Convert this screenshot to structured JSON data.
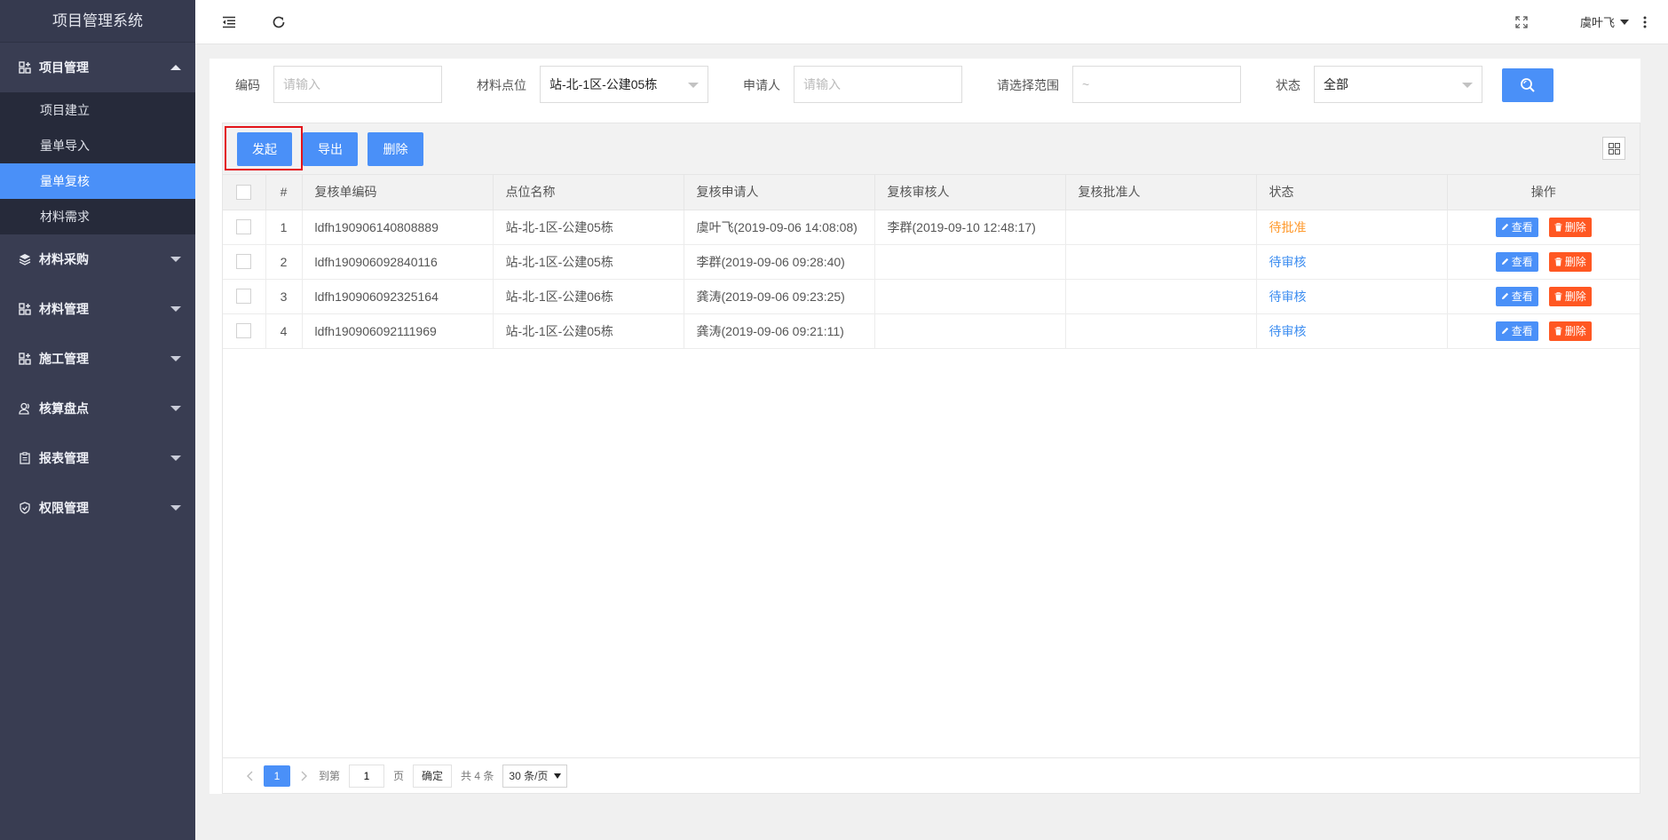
{
  "app": {
    "title": "项目管理系统"
  },
  "sidebar": {
    "groups": [
      {
        "label": "项目管理",
        "icon": "grid-plus-icon",
        "expanded": true,
        "items": [
          {
            "label": "项目建立",
            "active": false
          },
          {
            "label": "量单导入",
            "active": false
          },
          {
            "label": "量单复核",
            "active": true
          },
          {
            "label": "材料需求",
            "active": false
          }
        ]
      },
      {
        "label": "材料采购",
        "icon": "layers-icon",
        "expanded": false
      },
      {
        "label": "材料管理",
        "icon": "grid-plus-icon",
        "expanded": false
      },
      {
        "label": "施工管理",
        "icon": "grid-plus-icon",
        "expanded": false
      },
      {
        "label": "核算盘点",
        "icon": "user-group-icon",
        "expanded": false
      },
      {
        "label": "报表管理",
        "icon": "clipboard-icon",
        "expanded": false
      },
      {
        "label": "权限管理",
        "icon": "shield-check-icon",
        "expanded": false
      }
    ]
  },
  "topbar": {
    "menu_icon": "menu-indent-icon",
    "refresh_icon": "refresh-icon",
    "fullscreen_icon": "fullscreen-icon",
    "user_name": "虞叶飞",
    "more_icon": "more-vertical-icon"
  },
  "filters": {
    "code_label": "编码",
    "code_placeholder": "请输入",
    "site_label": "材料点位",
    "site_value": "站-北-1区-公建05栋",
    "applicant_label": "申请人",
    "applicant_placeholder": "请输入",
    "range_label": "请选择范围",
    "range_placeholder": "~",
    "status_label": "状态",
    "status_value": "全部",
    "search_icon": "search-icon"
  },
  "toolbar": {
    "start_label": "发起",
    "export_label": "导出",
    "delete_label": "删除",
    "columns_icon": "columns-grid-icon"
  },
  "table": {
    "columns": [
      "#",
      "复核单编码",
      "点位名称",
      "复核申请人",
      "复核审核人",
      "复核批准人",
      "状态",
      "操作"
    ],
    "rows": [
      {
        "index": "1",
        "code": "ldfh190906140808889",
        "site": "站-北-1区-公建05栋",
        "applicant": "虞叶飞(2019-09-06 14:08:08)",
        "reviewer": "李群(2019-09-10 12:48:17)",
        "approver": "",
        "status": "待批准",
        "status_color": "#ff9a2e"
      },
      {
        "index": "2",
        "code": "ldfh190906092840116",
        "site": "站-北-1区-公建05栋",
        "applicant": "李群(2019-09-06 09:28:40)",
        "reviewer": "",
        "approver": "",
        "status": "待审核",
        "status_color": "#3c8df0"
      },
      {
        "index": "3",
        "code": "ldfh190906092325164",
        "site": "站-北-1区-公建06栋",
        "applicant": "龚涛(2019-09-06 09:23:25)",
        "reviewer": "",
        "approver": "",
        "status": "待审核",
        "status_color": "#3c8df0"
      },
      {
        "index": "4",
        "code": "ldfh190906092111969",
        "site": "站-北-1区-公建05栋",
        "applicant": "龚涛(2019-09-06 09:21:11)",
        "reviewer": "",
        "approver": "",
        "status": "待审核",
        "status_color": "#3c8df0"
      }
    ],
    "view_label": "查看",
    "delete_label": "删除"
  },
  "pager": {
    "current_page": "1",
    "goto_label": "到第",
    "goto_value": "1",
    "page_unit": "页",
    "confirm_label": "确定",
    "total_label": "共 4 条",
    "page_size": "30 条/页"
  },
  "colors": {
    "sidebar_bg": "#393d52",
    "accent": "#4a90f8",
    "danger": "#ff5722",
    "pending_approve": "#ff9a2e",
    "pending_review": "#3c8df0"
  }
}
